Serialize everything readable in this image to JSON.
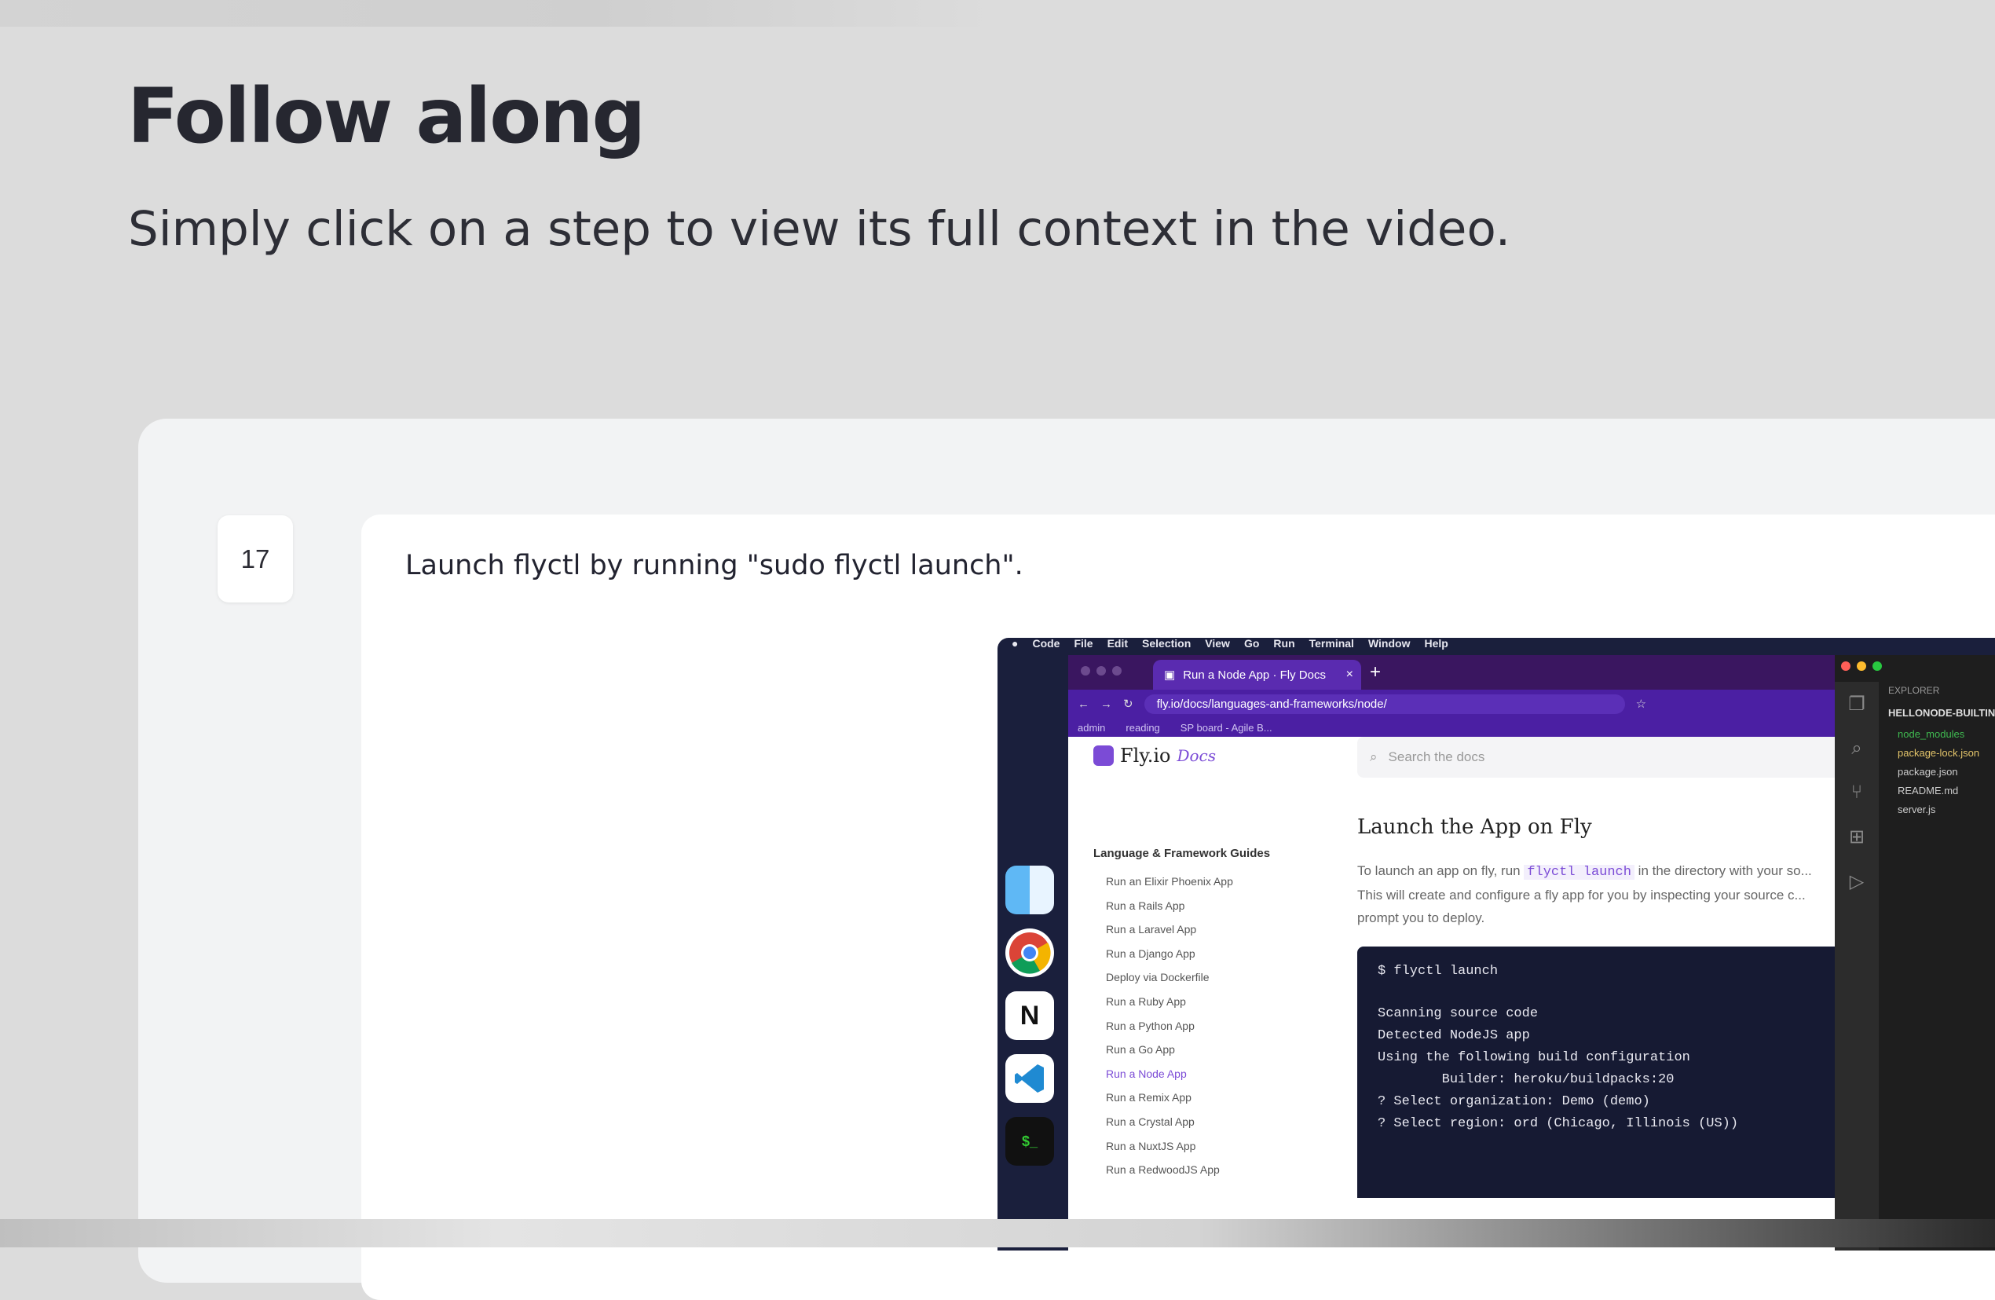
{
  "header": {
    "title": "Follow along",
    "subtitle": "Simply click on a step to view its full context in the video."
  },
  "step": {
    "number": "17",
    "text": "Launch flyctl by running \"sudo flyctl launch\"."
  },
  "screenshot": {
    "menubar": [
      "Code",
      "File",
      "Edit",
      "Selection",
      "View",
      "Go",
      "Run",
      "Terminal",
      "Window",
      "Help"
    ],
    "browser": {
      "tab_title": "Run a Node App · Fly Docs",
      "tab_close": "×",
      "new_tab": "+",
      "url": "fly.io/docs/languages-and-frameworks/node/",
      "bookmarks": [
        "admin",
        "reading",
        "SP board - Agile B..."
      ]
    },
    "docs": {
      "logo": "Fly.io",
      "logo_sub": "Docs",
      "search_placeholder": "Search the docs",
      "nav_title": "Language & Framework Guides",
      "nav_items": [
        "Run an Elixir Phoenix App",
        "Run a Rails App",
        "Run a Laravel App",
        "Run a Django App",
        "Deploy via Dockerfile",
        "Run a Ruby App",
        "Run a Python App",
        "Run a Go App",
        "Run a Node App",
        "Run a Remix App",
        "Run a Crystal App",
        "Run a NuxtJS App",
        "Run a RedwoodJS App"
      ],
      "heading": "Launch the App on Fly",
      "para_prefix": "To launch an app on fly, run ",
      "para_code": "flyctl launch",
      "para_suffix": " in the directory with your so...",
      "para_line2": "This will create and configure a fly app for you by inspecting your source c...",
      "para_line3": "prompt you to deploy.",
      "terminal_cmd": "$ flyctl launch",
      "terminal_lines": [
        "Scanning source code",
        "Detected NodeJS app",
        "Using the following build configuration",
        "        Builder: heroku/buildpacks:20",
        "? Select organization: Demo (demo)",
        "? Select region: ord (Chicago, Illinois (US))"
      ]
    },
    "vscode": {
      "explorer_title": "EXPLORER",
      "folder": "HELLONODE-BUILTIN",
      "files": [
        "node_modules",
        "package-lock.json",
        "package.json",
        "README.md",
        "server.js"
      ]
    }
  },
  "colors": {
    "page_bg": "#dcdcdc",
    "card_bg": "#f2f3f4",
    "accent": "#7b4bd6"
  }
}
